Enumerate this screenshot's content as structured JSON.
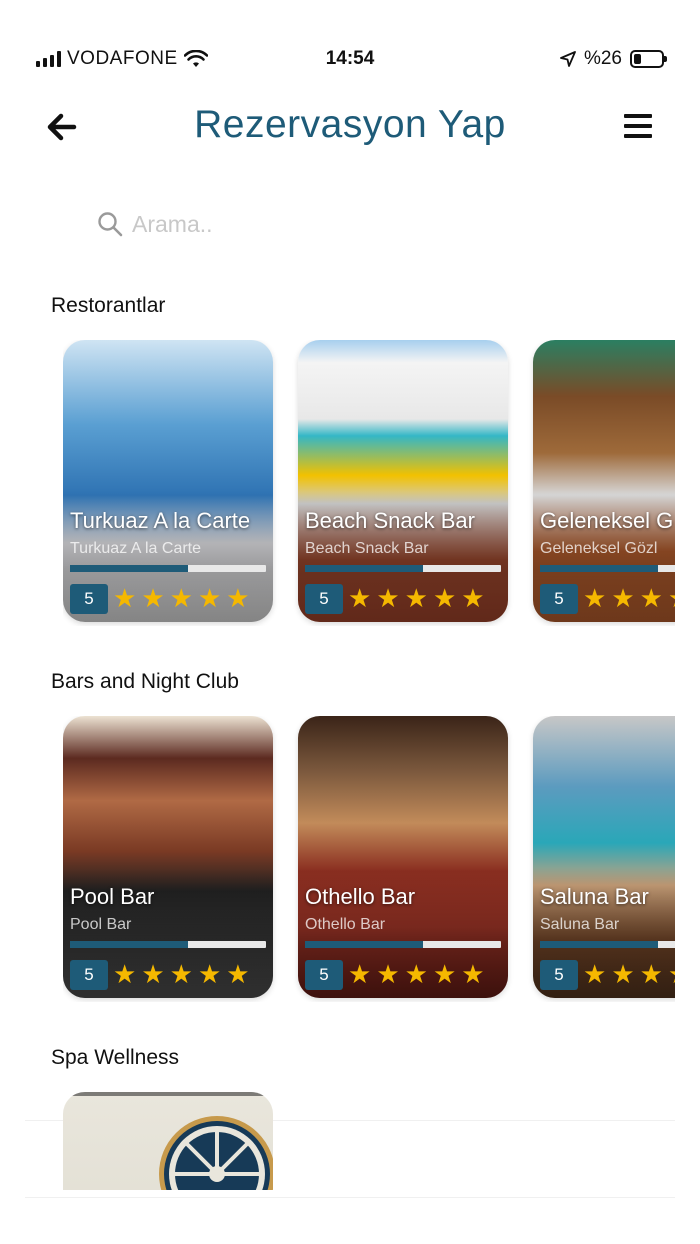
{
  "status_bar": {
    "carrier": "VODAFONE",
    "time": "14:54",
    "battery_text": "%26",
    "battery_level": 0.26
  },
  "header": {
    "title": "Rezervasyon Yap",
    "back_icon": "arrow-left-icon",
    "menu_icon": "hamburger-menu-icon"
  },
  "search": {
    "placeholder": "Arama..",
    "value": "",
    "icon": "search-icon"
  },
  "colors": {
    "accent": "#1e5b78",
    "star": "#f5b800",
    "placeholder": "#c8c8c8"
  },
  "sections": [
    {
      "title": "Restorantlar",
      "cards": [
        {
          "name": "Turkuaz A la Carte",
          "subtitle": "Turkuaz A la Carte",
          "score": "5",
          "rating": 5,
          "fill": 0.6
        },
        {
          "name": "Beach Snack Bar",
          "subtitle": "Beach Snack Bar",
          "score": "5",
          "rating": 5,
          "fill": 0.6
        },
        {
          "name": "Geleneksel G",
          "subtitle": "Geleneksel Gözl",
          "score": "5",
          "rating": 5,
          "fill": 0.6
        }
      ]
    },
    {
      "title": "Bars and Night Club",
      "cards": [
        {
          "name": "Pool Bar",
          "subtitle": "Pool Bar",
          "score": "5",
          "rating": 5,
          "fill": 0.6
        },
        {
          "name": "Othello Bar",
          "subtitle": "Othello Bar",
          "score": "5",
          "rating": 5,
          "fill": 0.6
        },
        {
          "name": "Saluna Bar",
          "subtitle": "Saluna Bar",
          "score": "5",
          "rating": 5,
          "fill": 0.6
        }
      ]
    },
    {
      "title": "Spa Wellness",
      "cards": []
    }
  ],
  "stars_symbol": "★"
}
